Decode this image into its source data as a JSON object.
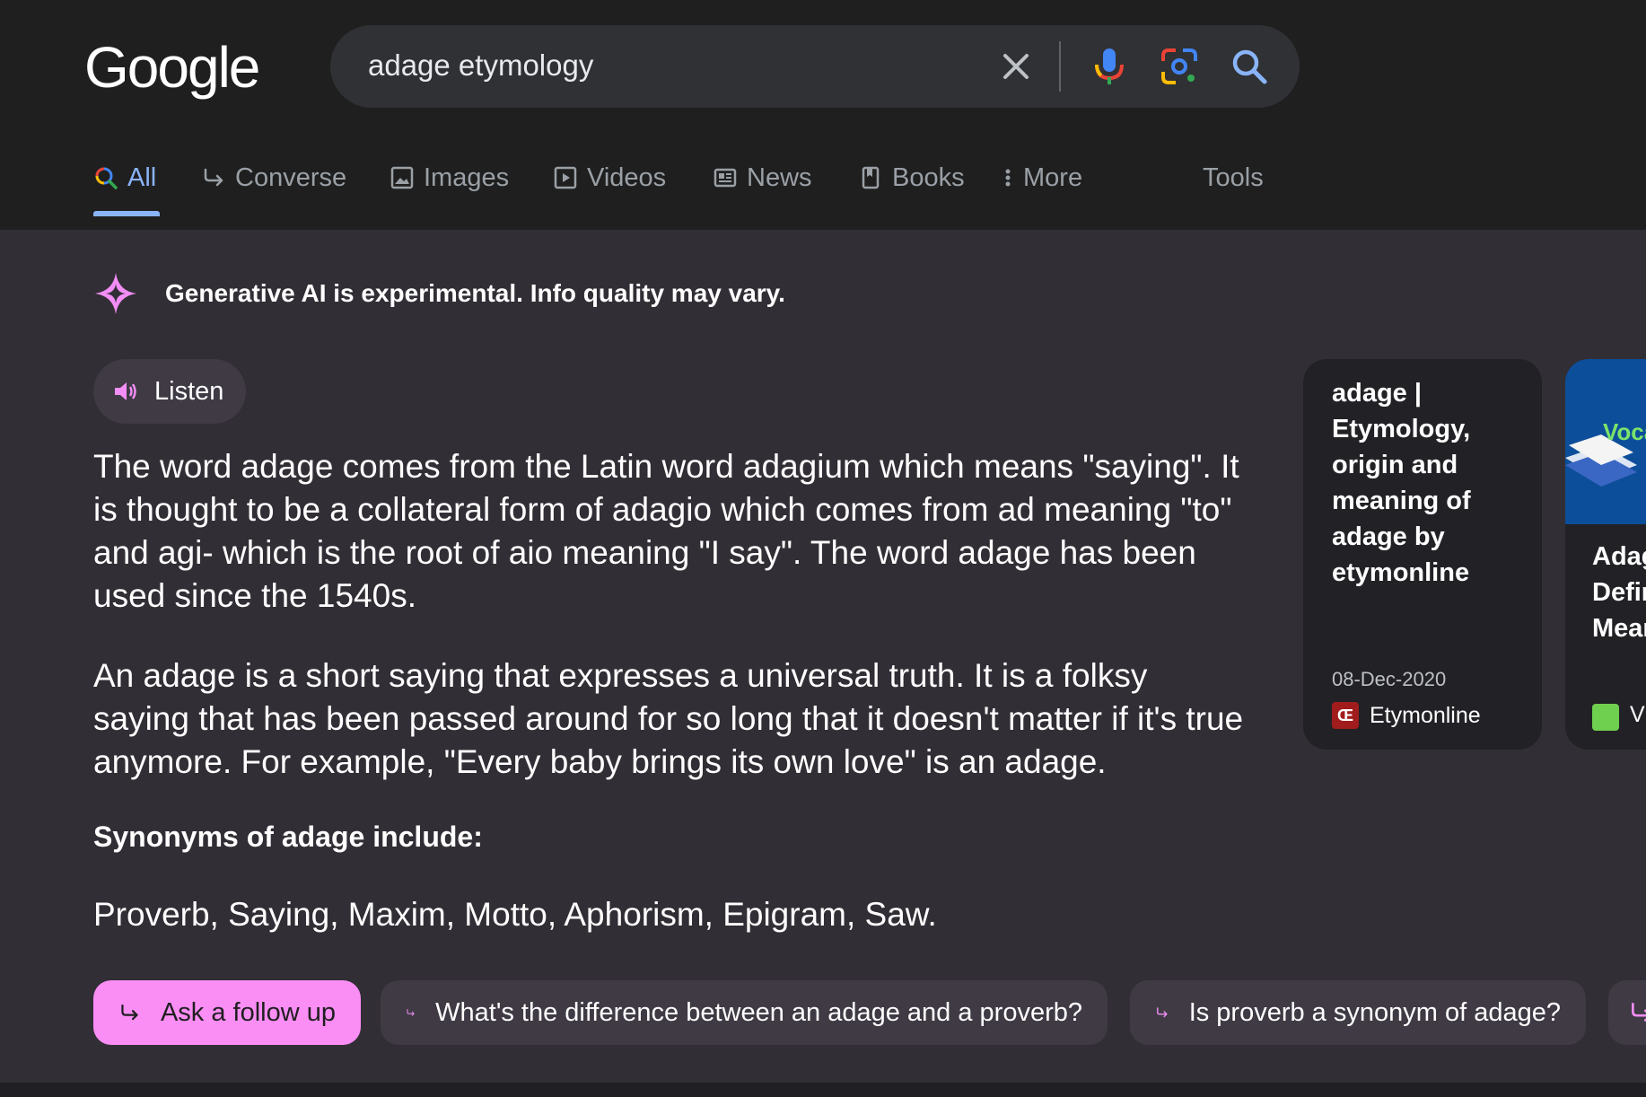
{
  "header": {
    "logo": "Google",
    "search": {
      "query": "adage etymology"
    },
    "tabs": [
      {
        "label": "All",
        "icon": "search-multicolor-icon",
        "active": true
      },
      {
        "label": "Converse",
        "icon": "follow-up-arrow-icon"
      },
      {
        "label": "Images",
        "icon": "image-icon"
      },
      {
        "label": "Videos",
        "icon": "play-icon"
      },
      {
        "label": "News",
        "icon": "newspaper-icon"
      },
      {
        "label": "Books",
        "icon": "book-icon"
      },
      {
        "label": "More",
        "icon": "more-vertical-icon"
      }
    ],
    "tools_label": "Tools"
  },
  "ai_overview": {
    "notice": "Generative AI is experimental. Info quality may vary.",
    "listen_label": "Listen",
    "paragraphs": [
      "The word adage comes from the Latin word adagium which means \"saying\". It is thought to be a collateral form of adagio which comes from ad meaning \"to\" and agi- which is the root of aio meaning \"I say\". The word adage has been used since the 1540s.",
      "An adage is a short saying that expresses a universal truth. It is a folksy saying that has been passed around for so long that it doesn't matter if it's true anymore. For example, \"Every baby brings its own love\" is an adage."
    ],
    "synonyms_heading": "Synonyms of adage include:",
    "synonyms": "Proverb, Saying, Maxim, Motto, Aphorism, Epigram, Saw.",
    "chips": {
      "ask": "Ask a follow up",
      "q1": "What's the difference between an adage and a proverb?",
      "q2": "Is proverb a synonym of adage?"
    }
  },
  "sources": [
    {
      "title": "adage | Etymology, origin and meaning of adage by etymonline",
      "date": "08-Dec-2020",
      "site": "Etymonline",
      "favicon_text": "Œ"
    },
    {
      "title": "Adag\nDefin\nMean",
      "image_text": "Voca",
      "site": "V"
    }
  ],
  "colors": {
    "header_bg": "#1f1f1f",
    "main_bg": "#322e35",
    "active_tab": "#8ab4f8",
    "ask_chip": "#fa8ef5",
    "ai_sparkle": "#f28ef5"
  }
}
